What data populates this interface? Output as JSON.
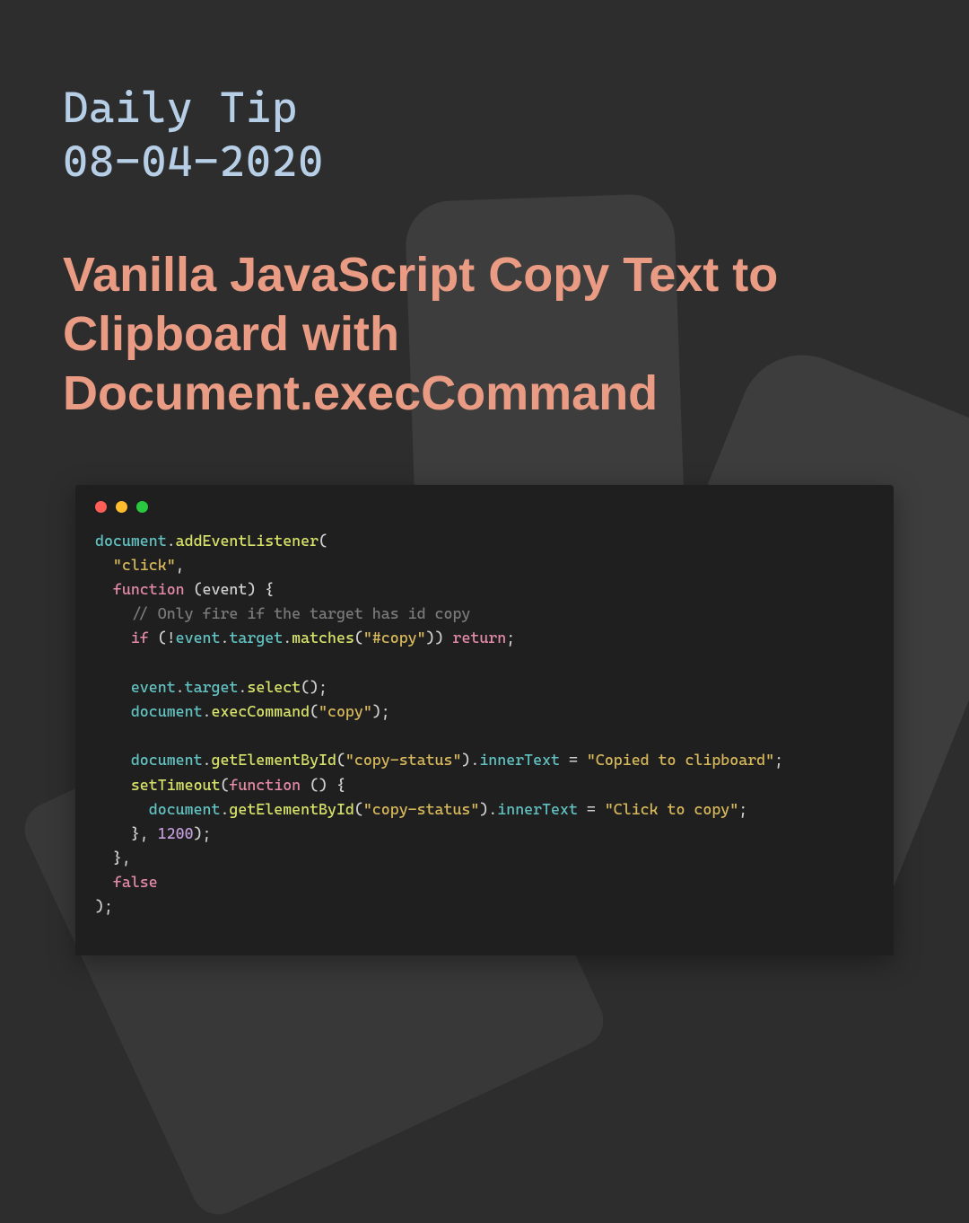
{
  "kicker": {
    "line1": "Daily Tip",
    "line2": "08-04-2020"
  },
  "title": "Vanilla JavaScript Copy Text to Clipboard with Document.execCommand",
  "code": {
    "l01_obj": "document",
    "l01_dot": ".",
    "l01_fn": "addEventListener",
    "l01_open": "(",
    "l02_str": "\"click\"",
    "l02_comma": ",",
    "l03_kw": "function",
    "l03_rest": " (event) {",
    "l04_cmt": "// Only fire if the target has id copy",
    "l05_if": "if",
    "l05_open": " (!",
    "l05_ev": "event",
    "l05_d1": ".",
    "l05_tgt": "target",
    "l05_d2": ".",
    "l05_fn": "matches",
    "l05_par": "(",
    "l05_str": "\"#copy\"",
    "l05_close": "))",
    "l05_sp": " ",
    "l05_ret": "return",
    "l05_semi": ";",
    "l06_ev": "event",
    "l06_d1": ".",
    "l06_tgt": "target",
    "l06_d2": ".",
    "l06_fn": "select",
    "l06_call": "();",
    "l07_obj": "document",
    "l07_d1": ".",
    "l07_fn": "execCommand",
    "l07_par": "(",
    "l07_str": "\"copy\"",
    "l07_close": ");",
    "l08_obj": "document",
    "l08_d1": ".",
    "l08_fn": "getElementById",
    "l08_par": "(",
    "l08_str": "\"copy-status\"",
    "l08_close": ").",
    "l08_prop": "innerText",
    "l08_eq": " = ",
    "l08_str2": "\"Copied to clipboard\"",
    "l08_semi": ";",
    "l09_fn": "setTimeout",
    "l09_par": "(",
    "l09_kw": "function",
    "l09_rest": " () {",
    "l10_obj": "document",
    "l10_d1": ".",
    "l10_fn": "getElementById",
    "l10_par": "(",
    "l10_str": "\"copy-status\"",
    "l10_close": ").",
    "l10_prop": "innerText",
    "l10_eq": " = ",
    "l10_str2": "\"Click to copy\"",
    "l10_semi": ";",
    "l11_close": "}, ",
    "l11_num": "1200",
    "l11_end": ");",
    "l12": "},",
    "l13": "false",
    "l14": ");"
  }
}
